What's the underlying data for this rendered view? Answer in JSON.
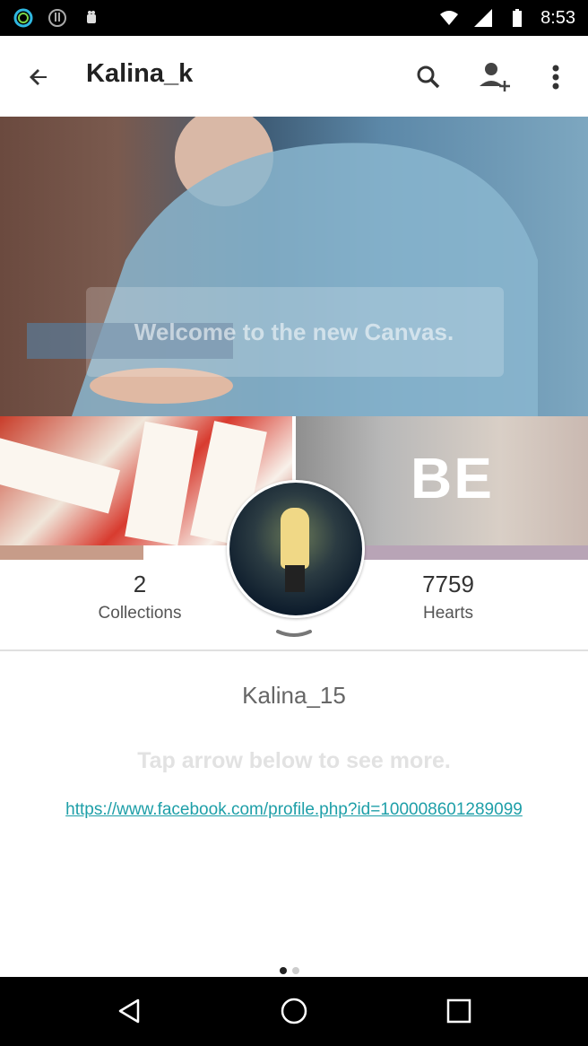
{
  "status_bar": {
    "time": "8:53",
    "icons_left": [
      "ring-app-icon",
      "alert-icon",
      "android-icon"
    ],
    "icons_right": [
      "wifi-icon",
      "signal-icon",
      "battery-icon"
    ]
  },
  "app_bar": {
    "title": "Kalina_k",
    "back_icon": "arrow-back-icon",
    "actions": [
      "search-icon",
      "add-person-icon",
      "more-vert-icon"
    ]
  },
  "hero": {
    "overlay_text": "Welcome to the new Canvas."
  },
  "grid": {
    "right_tile_text": "BE"
  },
  "stats": {
    "collections_count": "2",
    "collections_label": "Collections",
    "hearts_count": "7759",
    "hearts_label": "Hearts"
  },
  "profile": {
    "username": "Kalina_15",
    "hint": "Tap arrow below to see more.",
    "link": "https://www.facebook.com/profile.php?id=100008601289099"
  },
  "pager": {
    "active_color": "#222222",
    "inactive_color": "#cccccc"
  },
  "colors": {
    "accent_link": "#1e9fa8",
    "status_bar": "#000000"
  }
}
